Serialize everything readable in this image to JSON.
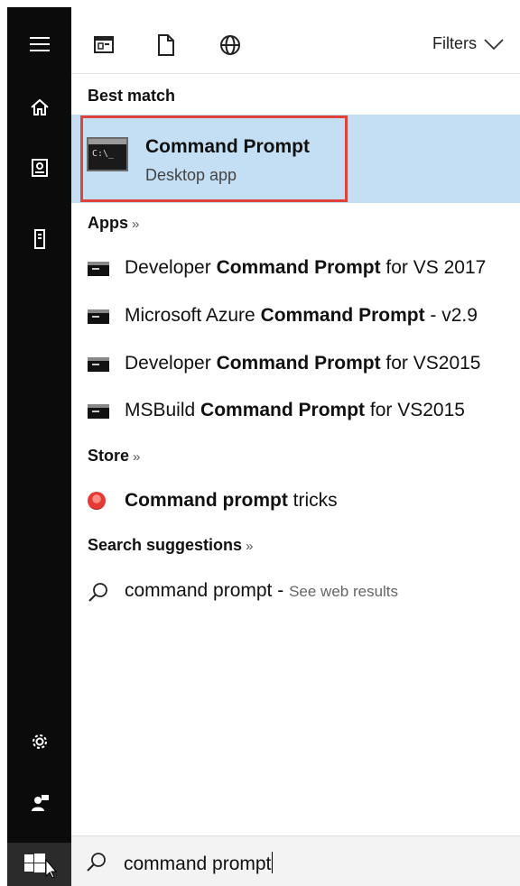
{
  "rail": {
    "items": [
      {
        "icon": "hamburger-menu-icon"
      },
      {
        "icon": "home-icon"
      },
      {
        "icon": "documents-icon"
      },
      {
        "icon": "tower-pc-icon"
      },
      {
        "icon": "settings-gear-icon"
      },
      {
        "icon": "user-feedback-icon"
      },
      {
        "icon": "windows-start-icon"
      }
    ]
  },
  "toolbar": {
    "scopes": [
      "apps-scope-icon",
      "documents-scope-icon",
      "web-scope-icon"
    ],
    "filters_label": "Filters"
  },
  "sections": {
    "best_match": "Best match",
    "apps": "Apps",
    "store": "Store",
    "search_suggestions": "Search suggestions",
    "more_chevron": "»"
  },
  "best_match": {
    "title": "Command Prompt",
    "subtitle": "Desktop app",
    "icon_text": "C:\\_"
  },
  "apps": [
    {
      "pre": "Developer ",
      "bold": "Command Prompt",
      "post": " for VS 2017"
    },
    {
      "pre": "Microsoft Azure ",
      "bold": "Command Prompt",
      "post": " - v2.9"
    },
    {
      "pre": "Developer ",
      "bold": "Command Prompt",
      "post": " for VS2015"
    },
    {
      "pre": "MSBuild ",
      "bold": "Command Prompt",
      "post": " for VS2015"
    }
  ],
  "store": [
    {
      "pre": "",
      "bold": "Command prompt",
      "post": " tricks"
    }
  ],
  "suggestion": {
    "query": "command prompt",
    "separator": " - ",
    "action": "See web results"
  },
  "search": {
    "value": "command prompt"
  },
  "colors": {
    "rail": "#0b0b0b",
    "highlight": "#c4dff3",
    "outline": "#e0433a"
  }
}
